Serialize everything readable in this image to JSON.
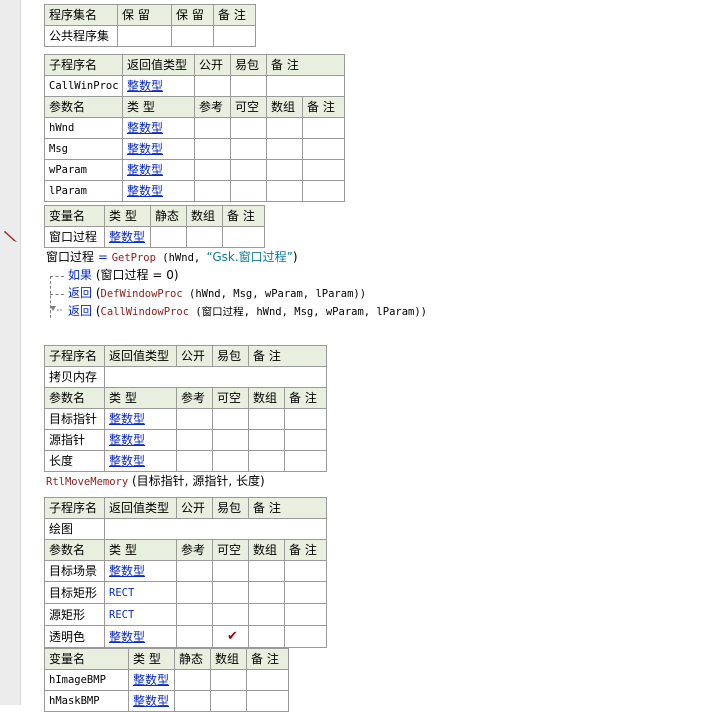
{
  "assembly_table": {
    "headers": [
      "程序集名",
      "保 留",
      "保 留",
      "备 注"
    ],
    "row": [
      "公共程序集",
      "",
      "",
      ""
    ]
  },
  "sub1": {
    "headers": [
      "子程序名",
      "返回值类型",
      "公开",
      "易包",
      "备 注"
    ],
    "name": "CallWinProc",
    "return_type": "整数型",
    "param_headers": [
      "参数名",
      "类 型",
      "参考",
      "可空",
      "数组",
      "备 注"
    ],
    "params": [
      {
        "name": "hWnd",
        "type": "整数型"
      },
      {
        "name": "Msg",
        "type": "整数型"
      },
      {
        "name": "wParam",
        "type": "整数型"
      },
      {
        "name": "lParam",
        "type": "整数型"
      }
    ],
    "var_headers": [
      "变量名",
      "类 型",
      "静态",
      "数组",
      "备 注"
    ],
    "vars": [
      {
        "name": "窗口过程",
        "type": "整数型"
      }
    ],
    "code": {
      "line1_var": "窗口过程",
      "line1_eq": " = ",
      "line1_fn": "GetProp",
      "line1_args": " (hWnd, ",
      "line1_str": "“Gsk.窗口过程”",
      "line1_close": ")",
      "line2_kw": "如果",
      "line2_rest": " (窗口过程 = 0)",
      "line3_kw": "返回",
      "line3_open": " (",
      "line3_fn": "DefWindowProc",
      "line3_rest": " (hWnd, Msg, wParam, lParam))",
      "line4_kw": "返回",
      "line4_open": " (",
      "line4_fn": "CallWindowProc",
      "line4_rest": " (窗口过程, hWnd, Msg, wParam, lParam))"
    }
  },
  "sub2": {
    "headers": [
      "子程序名",
      "返回值类型",
      "公开",
      "易包",
      "备 注"
    ],
    "name": "拷贝内存",
    "param_headers": [
      "参数名",
      "类 型",
      "参考",
      "可空",
      "数组",
      "备 注"
    ],
    "params": [
      {
        "name": "目标指针",
        "type": "整数型"
      },
      {
        "name": "源指针",
        "type": "整数型"
      },
      {
        "name": "长度",
        "type": "整数型"
      }
    ],
    "code": {
      "fn": "RtlMoveMemory",
      "rest": " (目标指针, 源指针, 长度)"
    }
  },
  "sub3": {
    "headers": [
      "子程序名",
      "返回值类型",
      "公开",
      "易包",
      "备 注"
    ],
    "name": "绘图",
    "param_headers": [
      "参数名",
      "类 型",
      "参考",
      "可空",
      "数组",
      "备 注"
    ],
    "params": [
      {
        "name": "目标场景",
        "type": "整数型",
        "nullable": false
      },
      {
        "name": "目标矩形",
        "type": "RECT",
        "nullable": false
      },
      {
        "name": "源矩形",
        "type": "RECT",
        "nullable": false
      },
      {
        "name": "透明色",
        "type": "整数型",
        "nullable": true
      }
    ],
    "checkmark": "✔",
    "var_headers": [
      "变量名",
      "类 型",
      "静态",
      "数组",
      "备 注"
    ],
    "vars": [
      {
        "name": "hImageBMP",
        "type": "整数型"
      },
      {
        "name": "hMaskBMP",
        "type": "整数型"
      }
    ]
  }
}
